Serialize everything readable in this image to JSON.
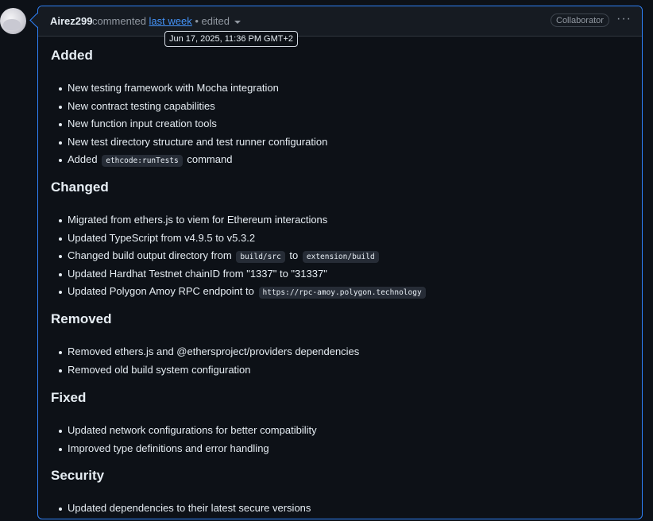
{
  "comment": {
    "author": "Airez299",
    "action": "commented",
    "time_link": "last week",
    "edited": "• edited",
    "badge": "Collaborator",
    "more": "···",
    "tooltip": "Jun 17, 2025, 11:36 PM GMT+2"
  },
  "sections": [
    {
      "heading": "Added",
      "items": [
        {
          "text": "New testing framework with Mocha integration"
        },
        {
          "text": "New contract testing capabilities"
        },
        {
          "text": "New function input creation tools"
        },
        {
          "text": "New test directory structure and test runner configuration"
        },
        {
          "pre": "Added",
          "code": "ethcode:runTests",
          "post": "command"
        }
      ]
    },
    {
      "heading": "Changed",
      "items": [
        {
          "text": "Migrated from ethers.js to viem for Ethereum interactions"
        },
        {
          "text": "Updated TypeScript from v4.9.5 to v5.3.2"
        },
        {
          "pre": "Changed build output directory from",
          "code": "build/src",
          "mid": "to",
          "code2": "extension/build"
        },
        {
          "text": "Updated Hardhat Testnet chainID from \"1337\" to \"31337\""
        },
        {
          "pre": "Updated Polygon Amoy RPC endpoint to",
          "code": "https://rpc-amoy.polygon.technology"
        }
      ]
    },
    {
      "heading": "Removed",
      "items": [
        {
          "text": "Removed ethers.js and @ethersproject/providers dependencies"
        },
        {
          "text": "Removed old build system configuration"
        }
      ]
    },
    {
      "heading": "Fixed",
      "items": [
        {
          "text": "Updated network configurations for better compatibility"
        },
        {
          "text": "Improved type definitions and error handling"
        }
      ]
    },
    {
      "heading": "Security",
      "items": [
        {
          "text": "Updated dependencies to their latest secure versions"
        }
      ]
    }
  ],
  "colors": {
    "background": "#0d1117",
    "header_bg": "#161b22",
    "accent_border": "#2f81f7",
    "link": "#4493f8",
    "muted": "#9198a1"
  },
  "icons": {
    "avatar": "user-avatar",
    "dropdown": "chevron-down-icon",
    "more": "kebab-horizontal-icon"
  }
}
